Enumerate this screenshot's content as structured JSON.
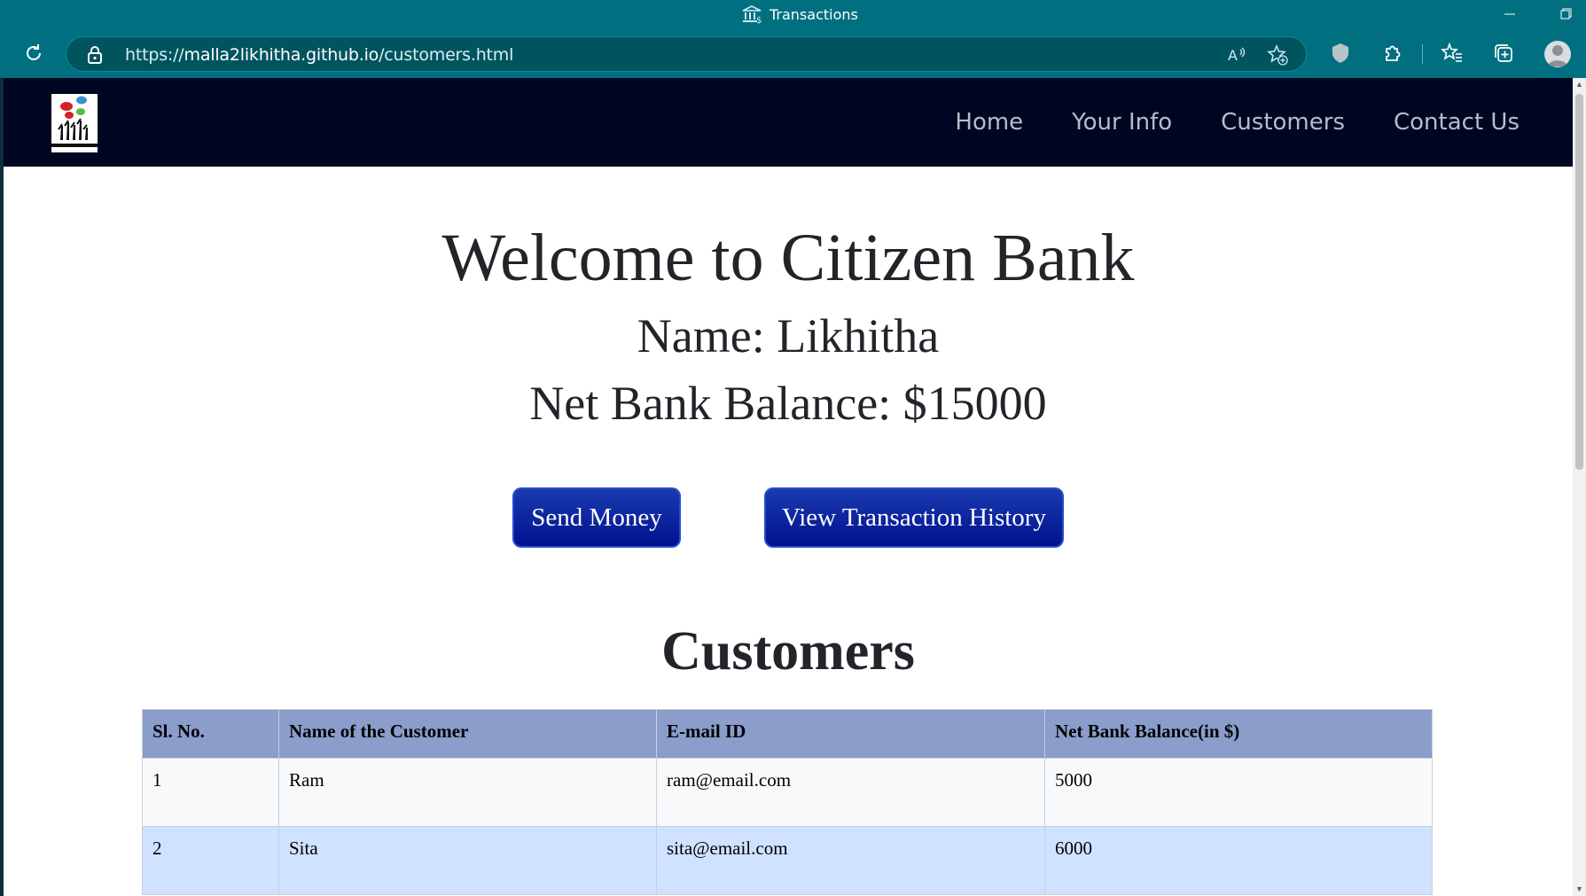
{
  "browser": {
    "tab_title": "Transactions",
    "url_prefix": "https://",
    "url_host": "malla2likhitha.github.io",
    "url_path": "/customers.html",
    "icons": [
      "bank-icon",
      "reload-icon",
      "lock-icon",
      "read-aloud-icon",
      "add-favorite-icon",
      "shield-icon",
      "extensions-icon",
      "favorites-icon",
      "collections-icon",
      "profile-icon"
    ]
  },
  "nav": {
    "links": [
      "Home",
      "Your Info",
      "Customers",
      "Contact Us"
    ]
  },
  "hero": {
    "welcome": "Welcome to Citizen Bank",
    "name": "Name: Likhitha",
    "balance": "Net Bank Balance: $15000"
  },
  "buttons": {
    "send": "Send Money",
    "history": "View Transaction History"
  },
  "customers": {
    "title": "Customers",
    "headers": [
      "Sl. No.",
      "Name of the Customer",
      "E-mail ID",
      "Net Bank Balance(in $)"
    ],
    "rows": [
      [
        "1",
        "Ram",
        "ram@email.com",
        "5000"
      ],
      [
        "2",
        "Sita",
        "sita@email.com",
        "6000"
      ]
    ]
  },
  "colors": {
    "browser_chrome": "#007080",
    "navbar": "#000522",
    "button": "#00118f",
    "table_header": "#8a9dcb",
    "row_alt": "#cfe2ff"
  }
}
